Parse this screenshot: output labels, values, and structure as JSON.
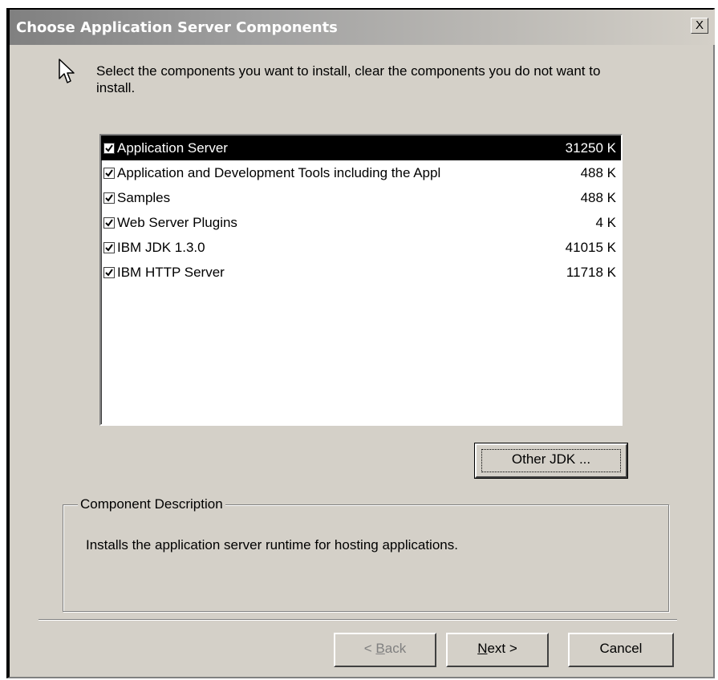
{
  "window": {
    "title": "Choose Application Server Components",
    "close_label": "X"
  },
  "instruction": "Select the components you want to install, clear the components you do not want to install.",
  "components": [
    {
      "name": "Application Server",
      "size": "31250 K",
      "checked": true,
      "selected": true
    },
    {
      "name": "Application and Development Tools including the Appl",
      "size": "488 K",
      "checked": true,
      "selected": false
    },
    {
      "name": "Samples",
      "size": "488 K",
      "checked": true,
      "selected": false
    },
    {
      "name": "Web Server Plugins",
      "size": "4 K",
      "checked": true,
      "selected": false
    },
    {
      "name": "IBM JDK 1.3.0",
      "size": "41015 K",
      "checked": true,
      "selected": false
    },
    {
      "name": "IBM HTTP Server",
      "size": "11718 K",
      "checked": true,
      "selected": false
    }
  ],
  "other_jdk_button": "Other JDK ...",
  "description_group": {
    "legend": "Component Description",
    "text": "Installs the application server runtime for hosting applications."
  },
  "buttons": {
    "back": {
      "prefix": "< ",
      "mnemonic": "B",
      "rest": "ack"
    },
    "next": {
      "mnemonic": "N",
      "rest": "ext >"
    },
    "cancel": "Cancel"
  },
  "icons": {
    "cursor": "arrow-cursor-icon",
    "checkbox": "checkmark-icon",
    "close": "close-icon"
  },
  "colors": {
    "selection_bg": "#000000",
    "dialog_bg": "#d4d0c8"
  }
}
